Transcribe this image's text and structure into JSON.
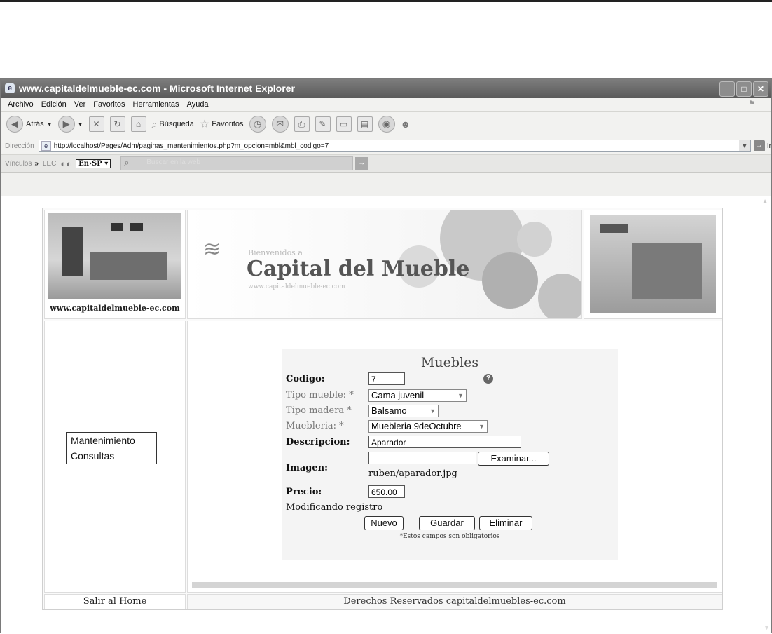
{
  "window": {
    "title": "www.capitaldelmueble-ec.com - Microsoft Internet Explorer"
  },
  "menubar": [
    "Archivo",
    "Edición",
    "Ver",
    "Favoritos",
    "Herramientas",
    "Ayuda"
  ],
  "toolbar": {
    "back_label": "Atrás",
    "search_label": "Búsqueda",
    "favorites_label": "Favoritos"
  },
  "address": {
    "label": "Dirección",
    "url": "http://localhost/Pages/Adm/paginas_mantenimientos.php?m_opcion=mbl&mbl_codigo=7",
    "go_label": "Ir"
  },
  "links": {
    "label": "Vínculos",
    "lec": "LEC",
    "translate": "En›SP ▾",
    "search_placeholder": "Buscar en la web"
  },
  "site": {
    "logo_text": "www.capitaldelmueble-ec.com",
    "banner_welcome": "Bienvenidos a",
    "banner_title": "Capital del Mueble",
    "banner_url": "www.capitaldelmueble-ec.com",
    "menu": [
      "Mantenimiento",
      "Consultas"
    ],
    "footer_link": "Salir al Home",
    "footer_text": "Derechos Reservados capitaldelmuebles-ec.com"
  },
  "form": {
    "title": "Muebles",
    "codigo_label": "Codigo:",
    "codigo_value": "7",
    "tipo_mueble_label": "Tipo mueble: *",
    "tipo_mueble_value": "Cama juvenil",
    "tipo_madera_label": "Tipo madera *",
    "tipo_madera_value": "Balsamo",
    "muebleria_label": "Muebleria: *",
    "muebleria_value": "Muebleria 9deOctubre",
    "descripcion_label": "Descripcion:",
    "descripcion_value": "Aparador",
    "imagen_label": "Imagen:",
    "imagen_value": "",
    "examinar_label": "Examinar...",
    "imagen_path": "ruben/aparador.jpg",
    "precio_label": "Precio:",
    "precio_value": "650.00",
    "status": "Modificando registro",
    "nuevo_label": "Nuevo",
    "guardar_label": "Guardar",
    "eliminar_label": "Eliminar",
    "required_note": "*Estos campos son obligatorios"
  }
}
